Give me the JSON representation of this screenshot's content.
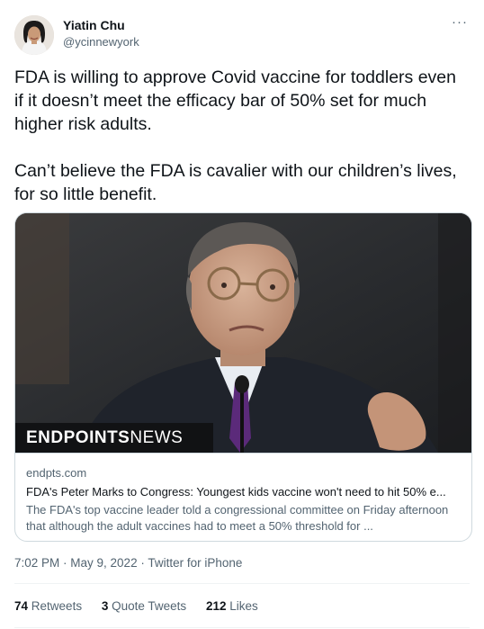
{
  "author": {
    "display_name": "Yiatin Chu",
    "handle": "@ycinnewyork"
  },
  "more_label": "···",
  "tweet_text": [
    "FDA is willing to approve Covid vaccine for toddlers even if it doesn’t meet the efficacy bar of 50% set for much higher risk adults.",
    "Can’t believe the FDA is cavalier with our children’s lives, for so little benefit."
  ],
  "card": {
    "brand_bold": "ENDPOINTS",
    "brand_light": "NEWS",
    "domain": "endpts.com",
    "title": "FDA's Peter Marks to Congress: Youngest kids vaccine won't need to hit 50% e...",
    "description": "The FDA's top vaccine leader told a congressional committee on Friday afternoon that although the adult vaccines had to meet a 50% threshold for ..."
  },
  "meta": {
    "time": "7:02 PM",
    "separator": " · ",
    "date": "May 9, 2022",
    "source": "Twitter for iPhone"
  },
  "stats": {
    "retweets_count": "74",
    "retweets_label": "Retweets",
    "quotes_count": "3",
    "quotes_label": "Quote Tweets",
    "likes_count": "212",
    "likes_label": "Likes"
  },
  "colors": {
    "text_primary": "#0f1419",
    "text_secondary": "#536471",
    "border": "#cfd9de",
    "divider": "#eff3f4"
  }
}
